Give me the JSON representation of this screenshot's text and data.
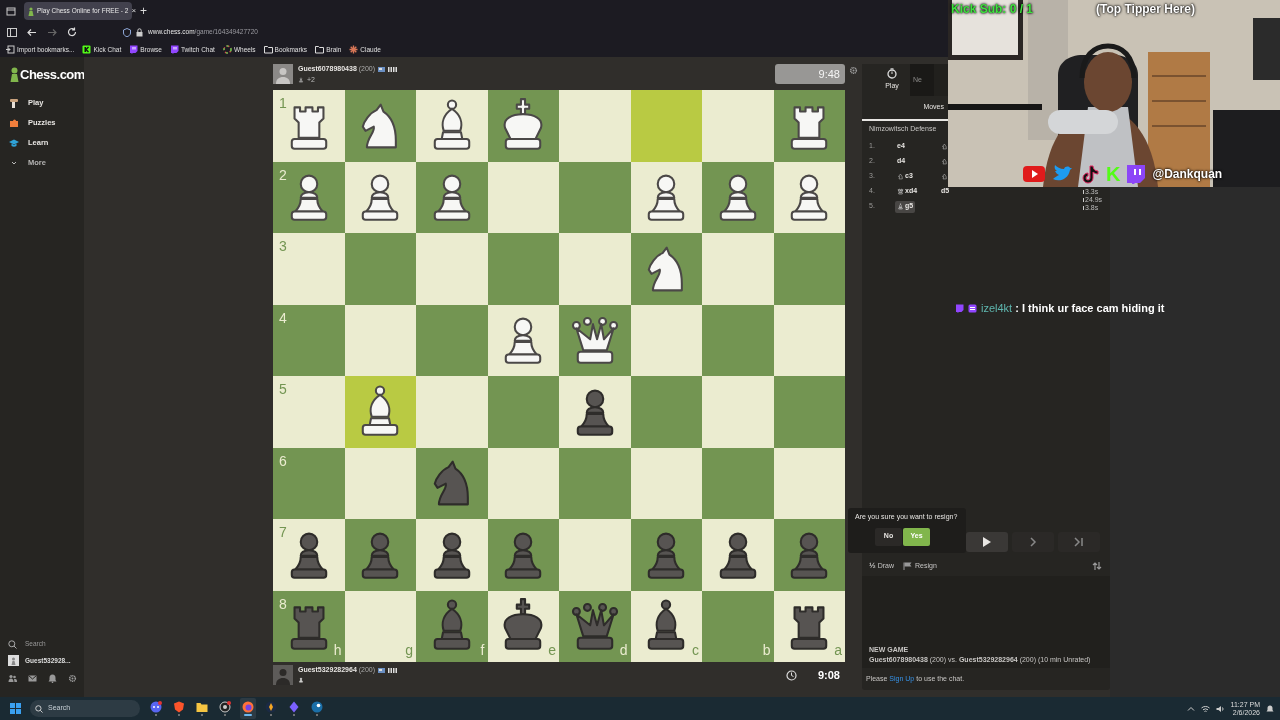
{
  "browser": {
    "tab": {
      "title": "Play Chess Online for FREE - 2",
      "close": "×",
      "selected": true
    },
    "new_tab": "+",
    "url": {
      "host": "www.chess.com",
      "path": "/game/164349427720"
    },
    "bookmarks": [
      {
        "label": "Import bookmarks...",
        "kind": "import"
      },
      {
        "label": "Kick Chat",
        "kind": "kick"
      },
      {
        "label": "Browse",
        "kind": "twitch"
      },
      {
        "label": "Twitch Chat",
        "kind": "twitch"
      },
      {
        "label": "Wheels",
        "kind": "wheel"
      },
      {
        "label": "Bookmarks",
        "kind": "folder"
      },
      {
        "label": "Brain",
        "kind": "folder"
      },
      {
        "label": "Claude",
        "kind": "claude"
      }
    ]
  },
  "sidebar": {
    "logo": "Chess.com",
    "items": [
      {
        "label": "Play",
        "kind": "play"
      },
      {
        "label": "Puzzles",
        "kind": "puzzles"
      },
      {
        "label": "Learn",
        "kind": "learn"
      },
      {
        "label": "More",
        "kind": "more"
      }
    ],
    "search": "Search",
    "user": "Guest532928..."
  },
  "top_player": {
    "name": "Guest6078980438",
    "rating": "(200)",
    "advantage": "+2"
  },
  "top_clock": {
    "time": "9:48",
    "active": false
  },
  "board": {
    "ranks": [
      {
        "label": "1",
        "squares": [
          {
            "kind": "rook",
            "black": false,
            "highlighted": false
          },
          {
            "kind": "knight",
            "black": false,
            "highlighted": false
          },
          {
            "kind": "bishop",
            "black": false,
            "highlighted": false
          },
          {
            "kind": "king",
            "black": false,
            "highlighted": false
          },
          {
            "highlighted": false
          },
          {
            "highlighted": true
          },
          {
            "highlighted": false
          },
          {
            "kind": "rook",
            "black": false,
            "highlighted": false
          }
        ]
      },
      {
        "label": "2",
        "squares": [
          {
            "kind": "pawn",
            "black": false,
            "highlighted": false
          },
          {
            "kind": "pawn",
            "black": false,
            "highlighted": false
          },
          {
            "kind": "pawn",
            "black": false,
            "highlighted": false
          },
          {
            "highlighted": false
          },
          {
            "highlighted": false
          },
          {
            "kind": "pawn",
            "black": false,
            "highlighted": false
          },
          {
            "kind": "pawn",
            "black": false,
            "highlighted": false
          },
          {
            "kind": "pawn",
            "black": false,
            "highlighted": false
          }
        ]
      },
      {
        "label": "3",
        "squares": [
          {
            "highlighted": false
          },
          {
            "highlighted": false
          },
          {
            "highlighted": false
          },
          {
            "highlighted": false
          },
          {
            "highlighted": false
          },
          {
            "kind": "knight",
            "black": false,
            "highlighted": false
          },
          {
            "highlighted": false
          },
          {
            "highlighted": false
          }
        ]
      },
      {
        "label": "4",
        "squares": [
          {
            "highlighted": false
          },
          {
            "highlighted": false
          },
          {
            "highlighted": false
          },
          {
            "kind": "pawn",
            "black": false,
            "highlighted": false
          },
          {
            "kind": "queen",
            "black": false,
            "highlighted": false
          },
          {
            "highlighted": false
          },
          {
            "highlighted": false
          },
          {
            "highlighted": false
          }
        ]
      },
      {
        "label": "5",
        "squares": [
          {
            "highlighted": false
          },
          {
            "kind": "bishop",
            "black": false,
            "highlighted": true
          },
          {
            "highlighted": false
          },
          {
            "highlighted": false
          },
          {
            "kind": "pawn",
            "black": true,
            "highlighted": false
          },
          {
            "highlighted": false
          },
          {
            "highlighted": false
          },
          {
            "highlighted": false
          }
        ]
      },
      {
        "label": "6",
        "squares": [
          {
            "highlighted": false
          },
          {
            "highlighted": false
          },
          {
            "kind": "knight",
            "black": true,
            "highlighted": false
          },
          {
            "highlighted": false
          },
          {
            "highlighted": false
          },
          {
            "highlighted": false
          },
          {
            "highlighted": false
          },
          {
            "highlighted": false
          }
        ]
      },
      {
        "label": "7",
        "squares": [
          {
            "kind": "pawn",
            "black": true,
            "highlighted": false
          },
          {
            "kind": "pawn",
            "black": true,
            "highlighted": false
          },
          {
            "kind": "pawn",
            "black": true,
            "highlighted": false
          },
          {
            "kind": "pawn",
            "black": true,
            "highlighted": false
          },
          {
            "highlighted": false
          },
          {
            "kind": "pawn",
            "black": true,
            "highlighted": false
          },
          {
            "kind": "pawn",
            "black": true,
            "highlighted": false
          },
          {
            "kind": "pawn",
            "black": true,
            "highlighted": false
          }
        ]
      },
      {
        "label": "8",
        "squares": [
          {
            "kind": "rook",
            "black": true,
            "highlighted": false
          },
          {
            "highlighted": false
          },
          {
            "kind": "bishop",
            "black": true,
            "highlighted": false
          },
          {
            "kind": "king",
            "black": true,
            "highlighted": false
          },
          {
            "kind": "queen",
            "black": true,
            "highlighted": false
          },
          {
            "kind": "bishop",
            "black": true,
            "highlighted": false
          },
          {
            "highlighted": false
          },
          {
            "kind": "rook",
            "black": true,
            "highlighted": false
          }
        ]
      }
    ],
    "files": [
      "h",
      "g",
      "f",
      "e",
      "d",
      "c",
      "b",
      "a"
    ]
  },
  "bottom_player": {
    "name": "Guest5329282964",
    "rating": "(200)"
  },
  "bottom_clock": {
    "time": "9:08",
    "active": true
  },
  "panel": {
    "tabs": [
      {
        "label": "Play",
        "selected": true
      },
      {
        "label": "Ne",
        "selected": false
      }
    ],
    "moves_header": "Moves",
    "opening": "Nimzowitsch Defense",
    "moves": [
      {
        "number": "1.",
        "white": {
          "text": "e4",
          "selected": false
        },
        "black": {
          "kind": "knight",
          "selected": false
        }
      },
      {
        "number": "2.",
        "white": {
          "text": "d4",
          "selected": false
        },
        "black": {
          "kind": "knight",
          "selected": false
        }
      },
      {
        "number": "3.",
        "white": {
          "kind": "knight",
          "text": "c3",
          "selected": false
        },
        "black": {
          "kind": "knight",
          "selected": false
        }
      },
      {
        "number": "4.",
        "white": {
          "kind": "queen",
          "text": "xd4",
          "selected": false
        },
        "black": {
          "text": "d5",
          "selected": false
        }
      },
      {
        "number": "5.",
        "white": {
          "kind": "bishop",
          "text": "g5",
          "selected": true
        }
      }
    ],
    "resign_prompt": {
      "question": "Are you sure you want to resign?",
      "buttons": [
        {
          "label": "No",
          "kind": "cancel"
        },
        {
          "label": "Yes",
          "kind": "confirm"
        }
      ]
    },
    "draw": {
      "symbol": "½",
      "label": "Draw"
    },
    "resign": "Resign",
    "chat": {
      "heading": "NEW GAME",
      "game": "**Guest6078980438** (200) vs. **Guest5329282964** (200) (10 min Unrated)",
      "notice_before": "Please",
      "link": "Sign Up",
      "notice_after": "to use the chat."
    }
  },
  "stream": {
    "sub_goal": "Kick Sub: 0 / 1",
    "top_tipper": "(Top Tipper Here)",
    "socials": [
      {
        "kind": "youtube"
      },
      {
        "kind": "twitter"
      },
      {
        "kind": "tiktok"
      },
      {
        "kind": "kick",
        "text": "K"
      },
      {
        "kind": "twitch"
      }
    ],
    "handle": "@Dankquan",
    "move_times": [
      "3.3s",
      "24.9s",
      "3.8s"
    ],
    "chat": {
      "user": "izel4kt",
      "message": ": I think ur face cam hiding it"
    }
  },
  "taskbar": {
    "search": "Search",
    "apps": [
      {
        "kind": "discord",
        "selected": false
      },
      {
        "kind": "brave",
        "selected": false
      },
      {
        "kind": "folder",
        "selected": false
      },
      {
        "kind": "obs",
        "selected": false
      },
      {
        "kind": "firefox",
        "selected": true
      },
      {
        "kind": "rocket",
        "selected": false
      },
      {
        "kind": "crystal",
        "selected": false
      },
      {
        "kind": "steam",
        "selected": false
      }
    ],
    "time": "11:27 PM",
    "date": "2/6/2026"
  }
}
